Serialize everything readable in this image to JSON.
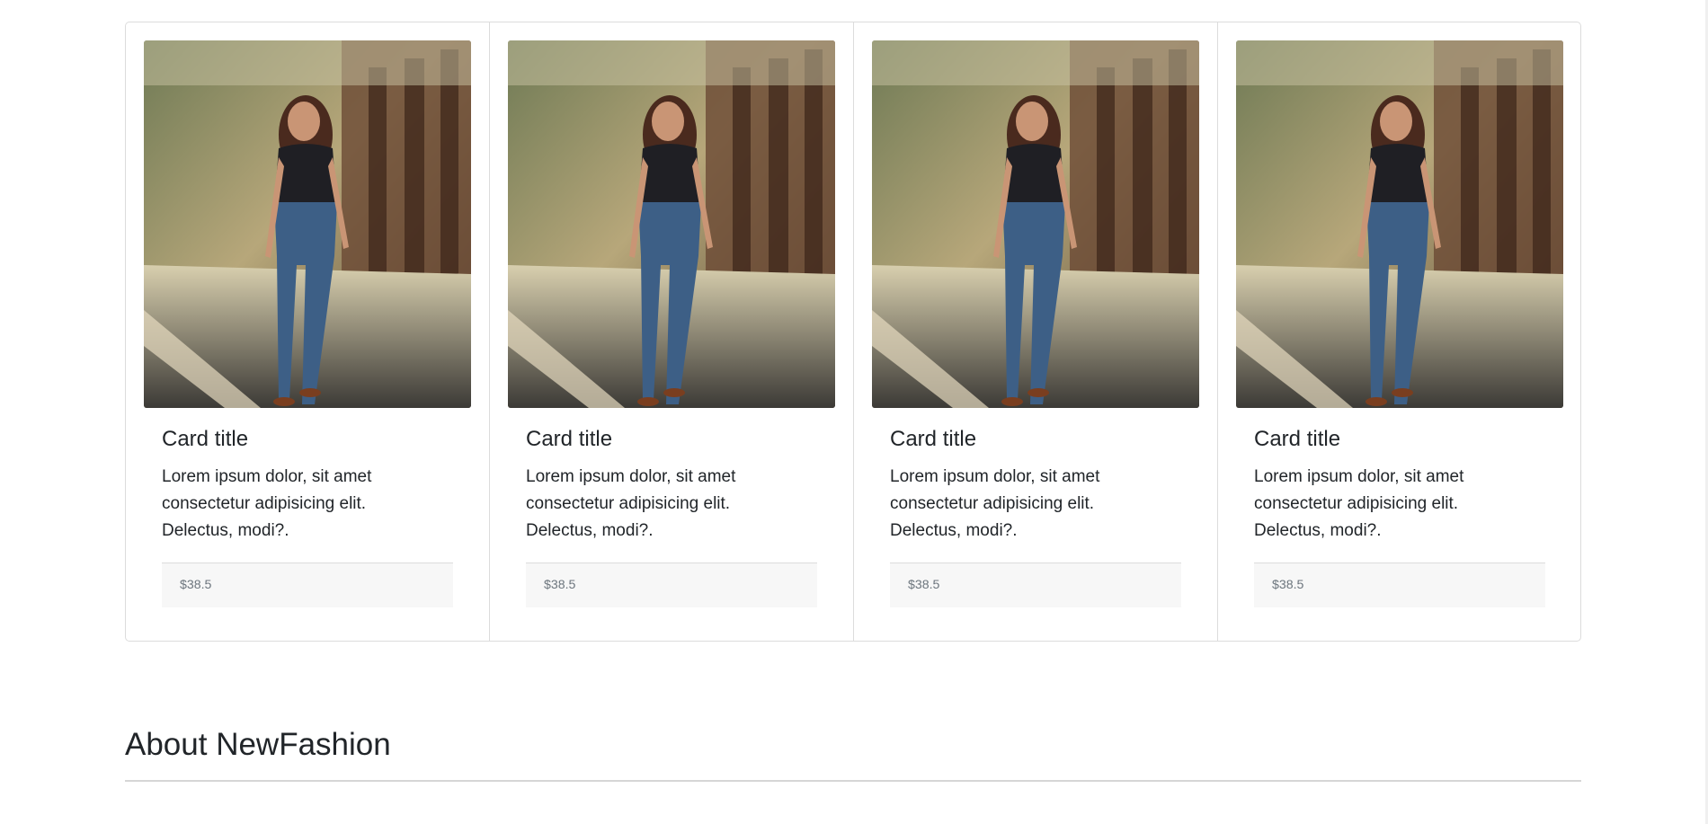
{
  "cards": [
    {
      "image_alt": "Woman in black top and ripped jeans",
      "title": "Card title",
      "text": "Lorem ipsum dolor, sit amet consectetur adipisicing elit. Delectus, modi?.",
      "price": "$38.5"
    },
    {
      "image_alt": "Woman in black top and ripped jeans",
      "title": "Card title",
      "text": "Lorem ipsum dolor, sit amet consectetur adipisicing elit. Delectus, modi?.",
      "price": "$38.5"
    },
    {
      "image_alt": "Woman in black top and ripped jeans",
      "title": "Card title",
      "text": "Lorem ipsum dolor, sit amet consectetur adipisicing elit. Delectus, modi?.",
      "price": "$38.5"
    },
    {
      "image_alt": "Woman in black top and ripped jeans",
      "title": "Card title",
      "text": "Lorem ipsum dolor, sit amet consectetur adipisicing elit. Delectus, modi?.",
      "price": "$38.5"
    }
  ],
  "about": {
    "heading": "About NewFashion"
  },
  "colors": {
    "border": "#dcdcdc",
    "footer_bg": "#f7f7f7",
    "muted_text": "#6c757d",
    "text": "#212529"
  }
}
